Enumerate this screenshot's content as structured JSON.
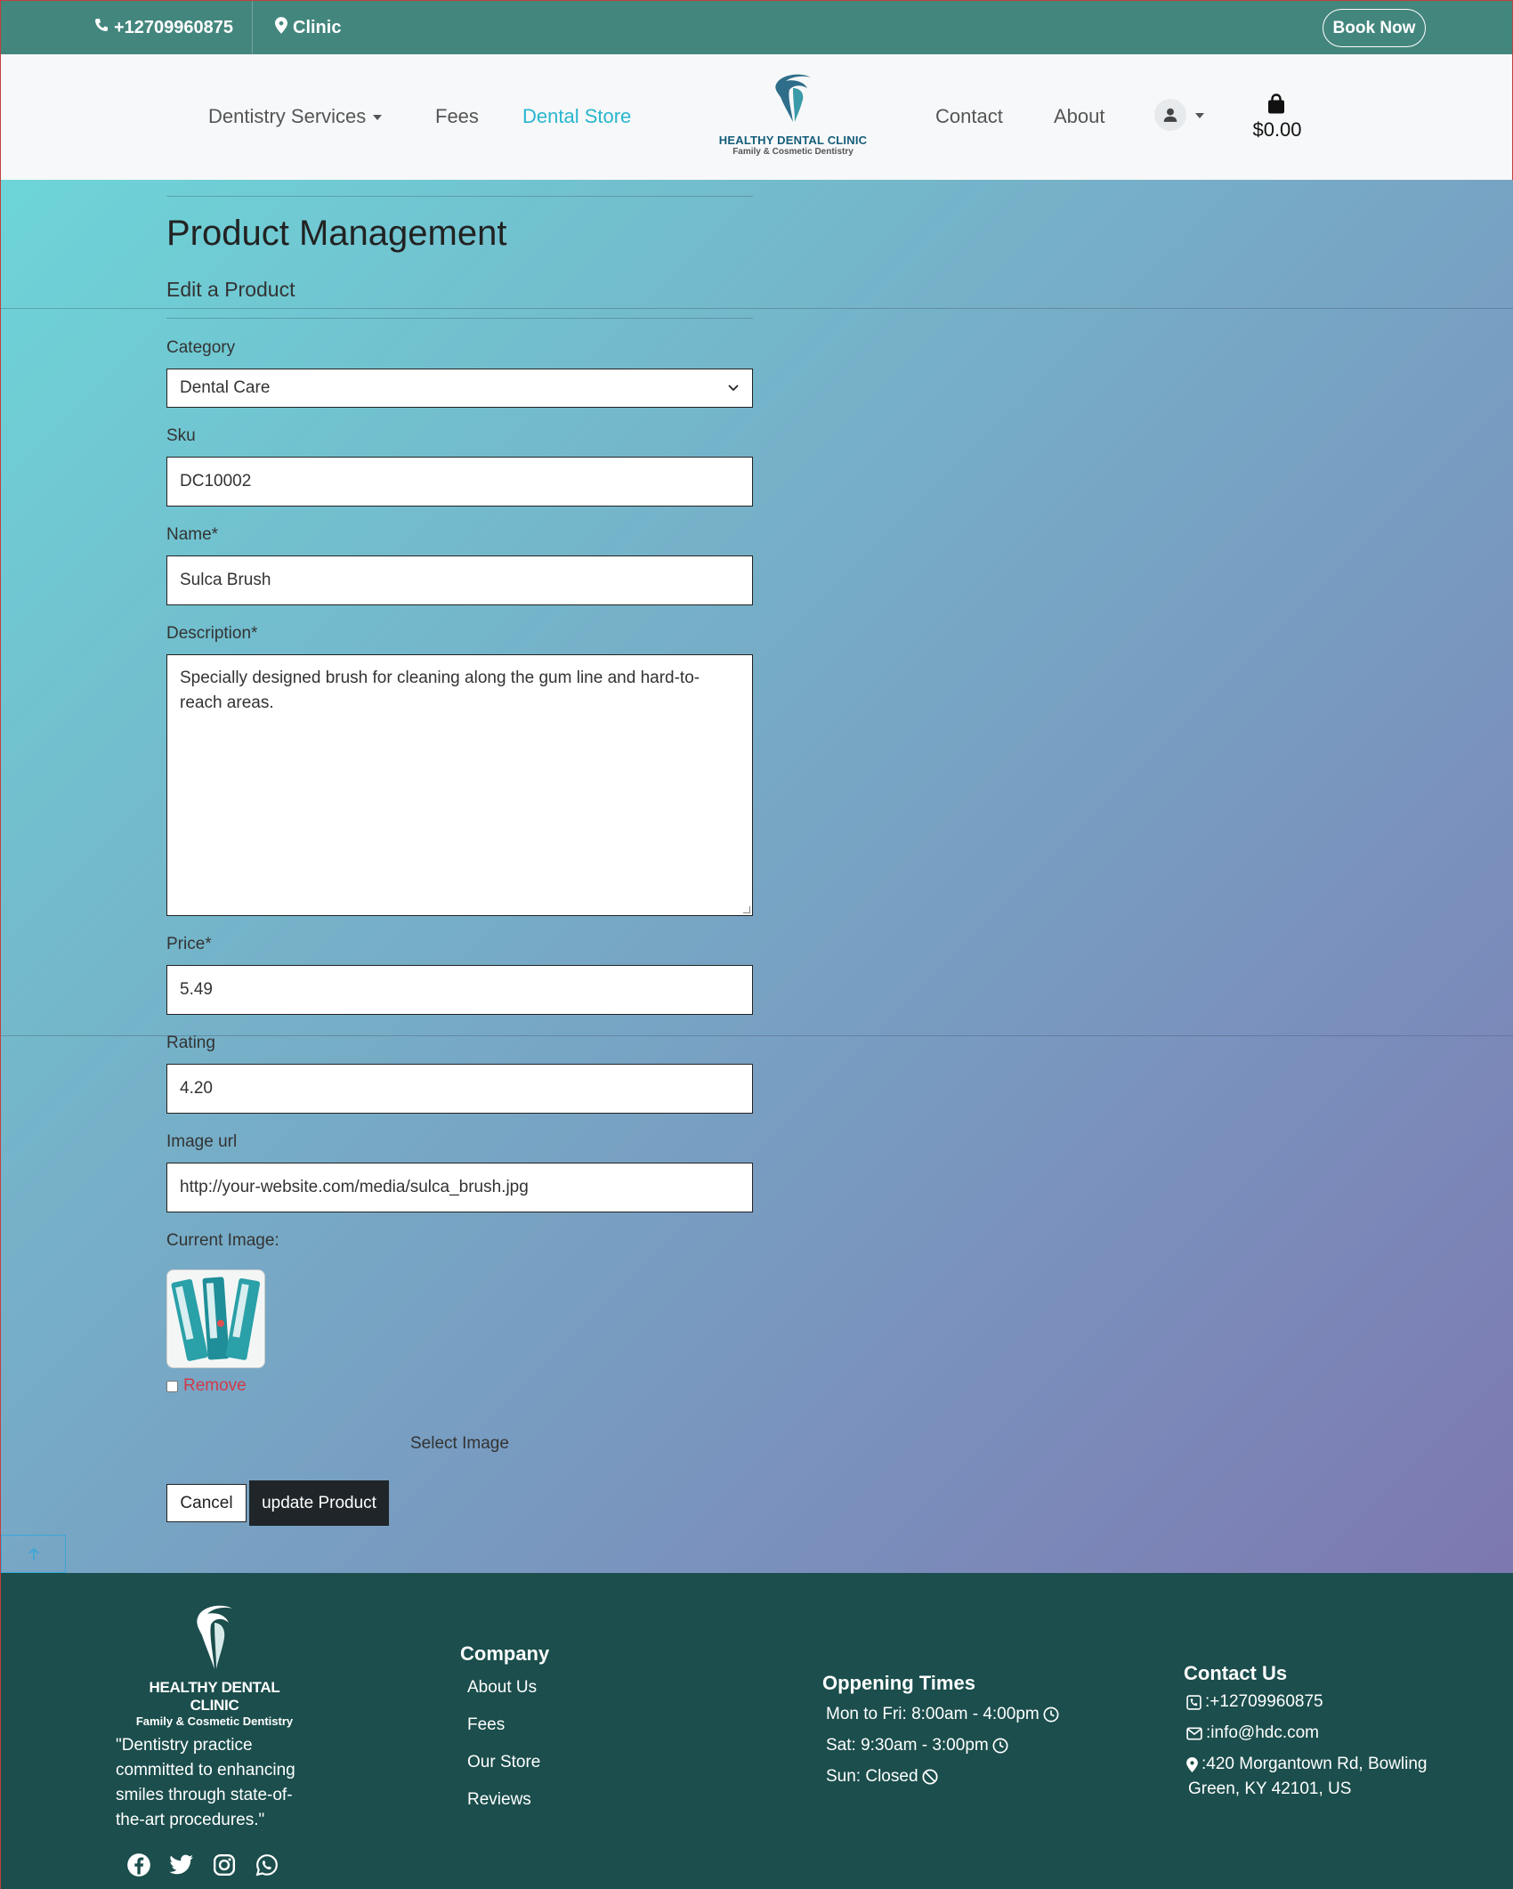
{
  "topbar": {
    "phone": "+12709960875",
    "location": "Clinic",
    "book_now": "Book Now"
  },
  "nav": {
    "services": "Dentistry Services",
    "fees": "Fees",
    "store": "Dental Store",
    "contact": "Contact",
    "about": "About",
    "cart_total": "$0.00",
    "logo_line1": "HEALTHY DENTAL CLINIC",
    "logo_line2": "Family & Cosmetic Dentistry"
  },
  "page": {
    "title": "Product Management",
    "subtitle": "Edit a Product"
  },
  "form": {
    "category_label": "Category",
    "category_value": "Dental Care",
    "sku_label": "Sku",
    "sku_value": "DC10002",
    "name_label": "Name*",
    "name_value": "Sulca Brush",
    "description_label": "Description*",
    "description_value": "Specially designed brush for cleaning along the gum line and hard-to-reach areas.",
    "price_label": "Price*",
    "price_value": "5.49",
    "rating_label": "Rating",
    "rating_value": "4.20",
    "image_url_label": "Image url",
    "image_url_value": "http://your-website.com/media/sulca_brush.jpg",
    "current_image_label": "Current Image:",
    "remove_label": "Remove",
    "select_image": "Select Image",
    "cancel": "Cancel",
    "update": "update Product"
  },
  "footer": {
    "logo_line1": "HEALTHY DENTAL CLINIC",
    "logo_line2": "Family & Cosmetic Dentistry",
    "quote": "\"Dentistry practice committed to enhancing smiles through state-of-the-art procedures.\"",
    "company_heading": "Company",
    "company_links": [
      "About Us",
      "Fees",
      "Our Store",
      "Reviews"
    ],
    "times_heading": "Oppening Times",
    "times": [
      "Mon to Fri: 8:00am - 4:00pm",
      "Sat: 9:30am - 3:00pm",
      "Sun: Closed"
    ],
    "contact_heading": "Contact Us",
    "contact_phone": ":+12709960875",
    "contact_email": ":info@hdc.com",
    "contact_address_1": ":420 Morgantown Rd, Bowling",
    "contact_address_2": "Green, KY 42101, US"
  },
  "icons": {
    "phone": "phone-icon",
    "pin": "map-pin-icon",
    "user": "user-icon",
    "bag": "shopping-bag-icon",
    "clock": "clock-icon",
    "ban": "ban-icon",
    "social": [
      "facebook-icon",
      "twitter-icon",
      "instagram-icon",
      "whatsapp-icon"
    ]
  },
  "colors": {
    "topbar": "#43867d",
    "footer": "#1b4e4c",
    "active_link": "#29b6cf",
    "remove": "#d03a4a"
  }
}
